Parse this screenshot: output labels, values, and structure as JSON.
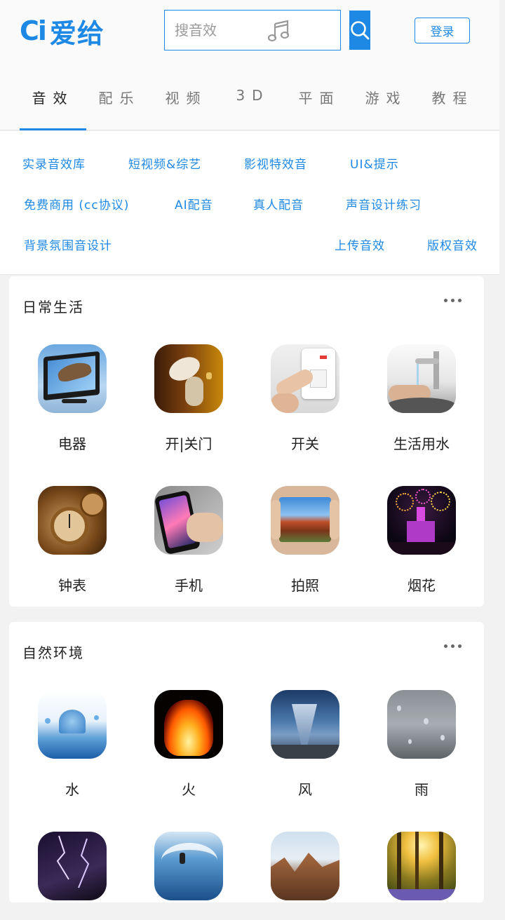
{
  "brand": {
    "mark": "Ci",
    "name": "爱给",
    "color": "#1e88e5"
  },
  "search": {
    "placeholder": "搜音效"
  },
  "login_label": "登录",
  "tabs": [
    {
      "label": "音效",
      "active": true
    },
    {
      "label": "配乐"
    },
    {
      "label": "视频"
    },
    {
      "label": "3D"
    },
    {
      "label": "平面"
    },
    {
      "label": "游戏"
    },
    {
      "label": "教程"
    }
  ],
  "subnav": [
    "实录音效库",
    "短视频&综艺",
    "影视特效音",
    "UI&提示",
    "免费商用 (cc协议)",
    "AI配音",
    "真人配音",
    "声音设计练习",
    "背景氛围音设计",
    "上传音效",
    "版权音效"
  ],
  "sections": [
    {
      "title": "日常生活",
      "items": [
        {
          "label": "电器",
          "icon": "tv-eagle-image"
        },
        {
          "label": "开|关门",
          "icon": "door-hand-image"
        },
        {
          "label": "开关",
          "icon": "light-switch-image"
        },
        {
          "label": "生活用水",
          "icon": "faucet-image"
        },
        {
          "label": "钟表",
          "icon": "pocket-watch-image"
        },
        {
          "label": "手机",
          "icon": "smartphone-image"
        },
        {
          "label": "拍照",
          "icon": "photo-landscape-image"
        },
        {
          "label": "烟花",
          "icon": "fireworks-castle-image"
        }
      ]
    },
    {
      "title": "自然环境",
      "items": [
        {
          "label": "水",
          "icon": "water-splash-image"
        },
        {
          "label": "火",
          "icon": "fire-image"
        },
        {
          "label": "风",
          "icon": "tornado-image"
        },
        {
          "label": "雨",
          "icon": "rain-glass-image"
        },
        {
          "label": "",
          "icon": "lightning-image"
        },
        {
          "label": "",
          "icon": "surf-wave-image"
        },
        {
          "label": "",
          "icon": "mountain-image"
        },
        {
          "label": "",
          "icon": "forest-sunlight-image"
        }
      ]
    }
  ]
}
